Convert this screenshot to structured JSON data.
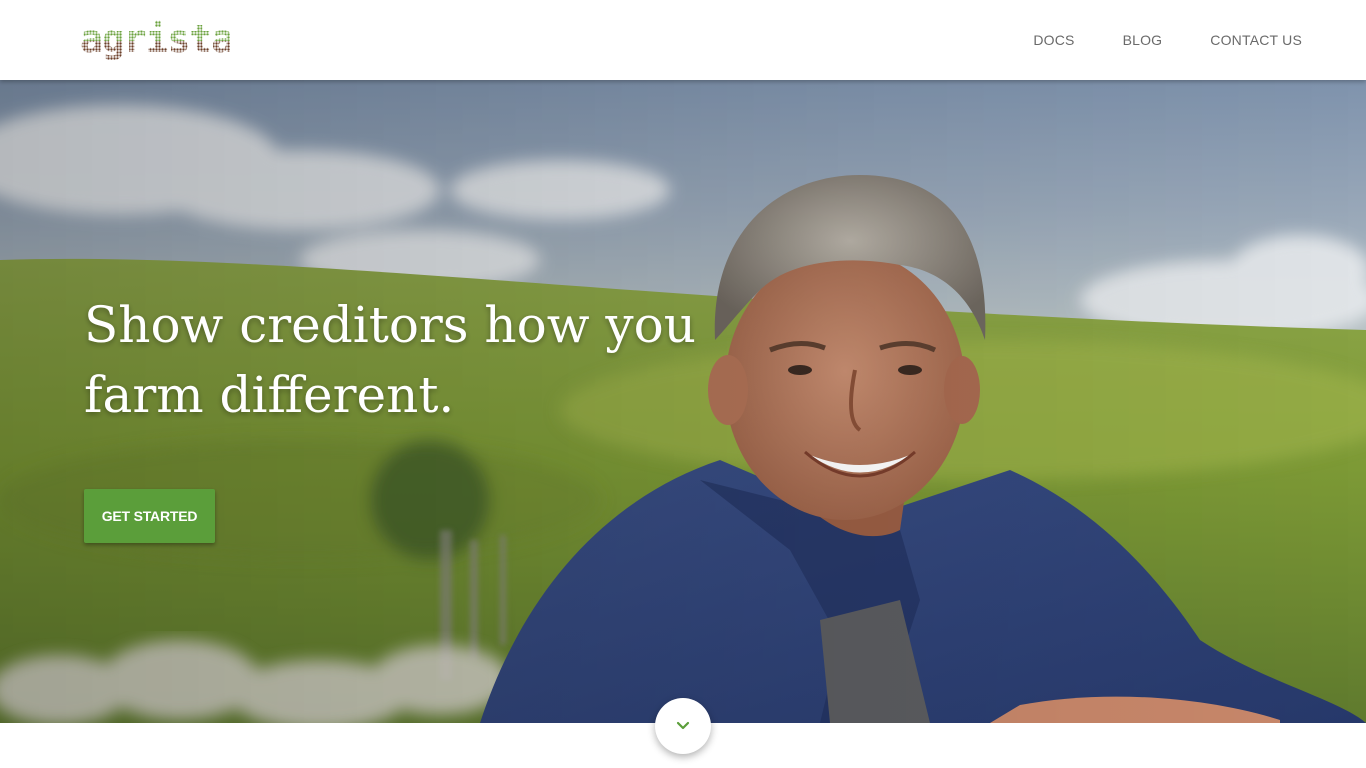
{
  "brand": {
    "name": "agrista",
    "colors": {
      "green": "#6ba23e",
      "brown": "#6b3f2a"
    }
  },
  "nav": {
    "items": [
      {
        "id": "docs",
        "label": "DOCS"
      },
      {
        "id": "blog",
        "label": "BLOG"
      },
      {
        "id": "contact",
        "label": "CONTACT US"
      }
    ]
  },
  "hero": {
    "headline_line1": "Show creditors how you",
    "headline_line2": "farm different.",
    "cta_label": "GET STARTED",
    "cta_color": "#5b9e3a",
    "scroll_icon": "chevron-down-icon"
  }
}
